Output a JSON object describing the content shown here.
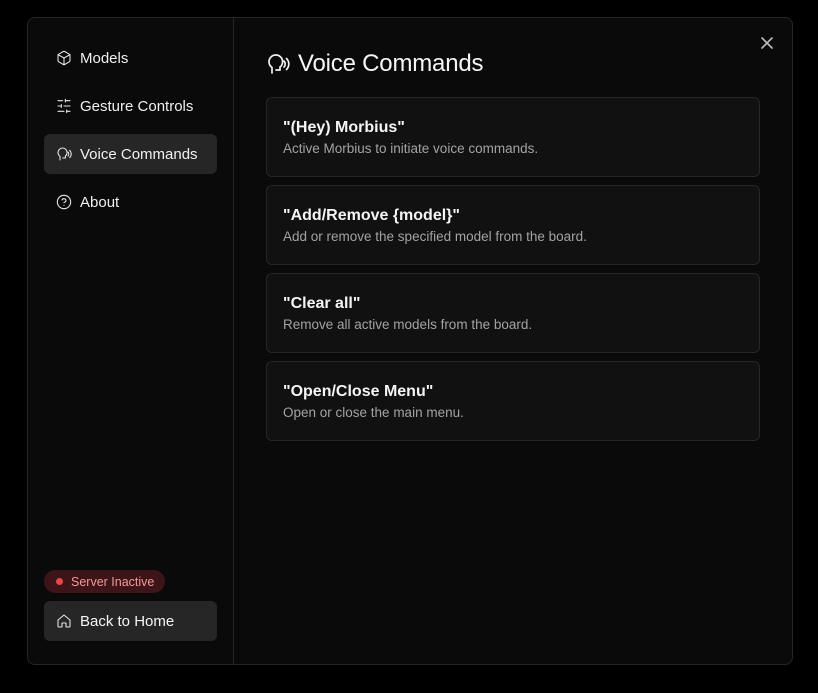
{
  "sidebar": {
    "items": [
      {
        "label": "Models",
        "icon": "cube-icon",
        "active": false
      },
      {
        "label": "Gesture Controls",
        "icon": "sliders-icon",
        "active": false
      },
      {
        "label": "Voice Commands",
        "icon": "voice-icon",
        "active": true
      },
      {
        "label": "About",
        "icon": "help-circle-icon",
        "active": false
      }
    ],
    "status": {
      "label": "Server Inactive",
      "color": "#ef4444"
    },
    "home_button": {
      "label": "Back to Home",
      "icon": "home-icon"
    }
  },
  "main": {
    "title": "Voice Commands",
    "title_icon": "voice-icon",
    "commands": [
      {
        "phrase": "\"(Hey) Morbius\"",
        "description": "Active Morbius to initiate voice commands."
      },
      {
        "phrase": "\"Add/Remove {model}\"",
        "description": "Add or remove the specified model from the board."
      },
      {
        "phrase": "\"Clear all\"",
        "description": "Remove all active models from the board."
      },
      {
        "phrase": "\"Open/Close Menu\"",
        "description": "Open or close the main menu."
      }
    ]
  },
  "colors": {
    "background": "#0a0a0a",
    "border": "#262626",
    "active_item": "#262626",
    "status_badge_bg": "#3d1418",
    "status_text": "#f19a9a"
  }
}
